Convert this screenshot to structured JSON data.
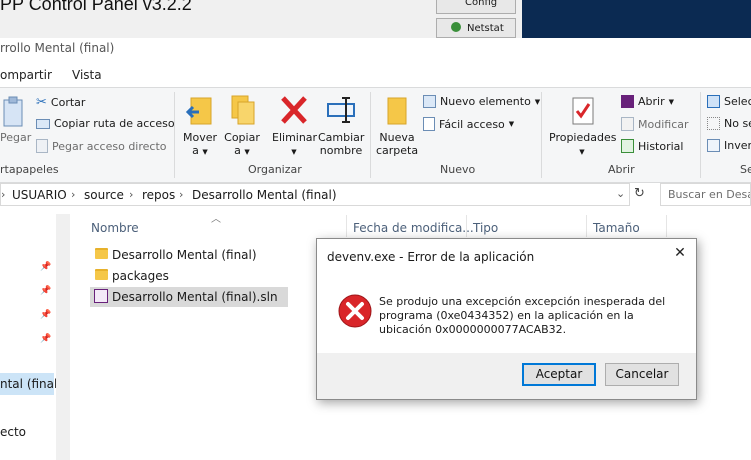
{
  "xampp": {
    "title": "PP Control Panel v3.2.2",
    "config_label": "Config",
    "netstat_label": "Netstat"
  },
  "explorer": {
    "window_title": "rrollo Mental (final)",
    "tabs": [
      "ompartir",
      "Vista"
    ],
    "ribbon": {
      "portapapeles": {
        "group_label": "rtapapeles",
        "pegar": "Pegar",
        "cortar": "Cortar",
        "copiar_ruta": "Copiar ruta de acceso",
        "pegar_acceso": "Pegar acceso directo"
      },
      "organizar": {
        "group_label": "Organizar",
        "mover_1": "Mover",
        "mover_2": "a",
        "copiar_1": "Copiar",
        "copiar_2": "a",
        "eliminar": "Eliminar",
        "cambiar_1": "Cambiar",
        "cambiar_2": "nombre"
      },
      "nuevo": {
        "group_label": "Nuevo",
        "nueva_1": "Nueva",
        "nueva_2": "carpeta",
        "nuevo_elemento": "Nuevo elemento",
        "facil_acceso": "Fácil acceso"
      },
      "abrir": {
        "group_label": "Abrir",
        "propiedades": "Propiedades",
        "abrir": "Abrir",
        "modificar": "Modificar",
        "historial": "Historial"
      },
      "seleccionar": {
        "group_label": "Se",
        "item1": "Selec",
        "item2": "No se",
        "item3": "Inver"
      }
    },
    "breadcrumbs": [
      "USUARIO",
      "source",
      "repos",
      "Desarrollo Mental (final)"
    ],
    "search_placeholder": "Buscar en Desarr",
    "columns": {
      "name": "Nombre",
      "date": "Fecha de modifica...",
      "type": "Tipo",
      "size": "Tamaño"
    },
    "files": [
      {
        "name": "Desarrollo Mental (final)",
        "kind": "folder"
      },
      {
        "name": "packages",
        "kind": "folder"
      },
      {
        "name": "Desarrollo Mental (final).sln",
        "kind": "sln"
      }
    ],
    "nav": {
      "item_selected": "ntal (final)",
      "item_bottom": "ecto"
    }
  },
  "dialog": {
    "title": "devenv.exe - Error de la aplicación",
    "message": "Se produjo una excepción excepción inesperada del programa (0xe0434352) en la aplicación en la ubicación 0x0000000077ACAB32.",
    "accept_label": "Aceptar",
    "cancel_label": "Cancelar"
  },
  "colors": {
    "accent": "#0078d7",
    "error_red": "#d9262a",
    "folder_yellow": "#f5c748",
    "desktop_blue": "#0b2a52"
  }
}
